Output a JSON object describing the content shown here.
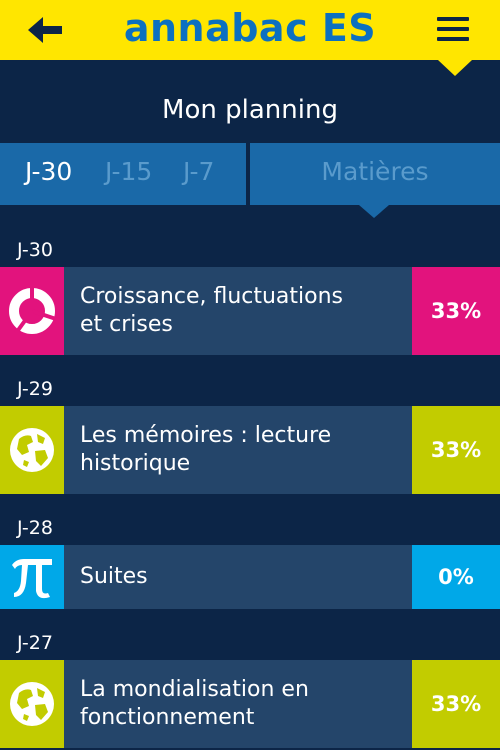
{
  "header": {
    "back_icon": "arrow-left-icon",
    "title": "annabac ES",
    "menu_icon": "hamburger-menu-icon",
    "colors": {
      "bar": "#ffe600",
      "title": "#0c70c0"
    }
  },
  "page": {
    "title": "Mon planning"
  },
  "tabs": {
    "days": [
      {
        "label": "J-30",
        "active": true
      },
      {
        "label": "J-15",
        "active": false
      },
      {
        "label": "J-7",
        "active": false
      }
    ],
    "subjects_label": "Matières",
    "selected": "Matières"
  },
  "planning": [
    {
      "day": "J-30",
      "title_lines": [
        "Croissance, fluctuations",
        "et crises"
      ],
      "percent": "33%",
      "color": "#e2137d",
      "icon": "economics-ring-icon"
    },
    {
      "day": "J-29",
      "title_lines": [
        "Les mémoires : lecture",
        "historique"
      ],
      "percent": "33%",
      "color": "#c2cc00",
      "icon": "globe-icon"
    },
    {
      "day": "J-28",
      "title_lines": [
        "Suites"
      ],
      "percent": "0%",
      "color": "#00a8e8",
      "icon": "pi-icon"
    },
    {
      "day": "J-27",
      "title_lines": [
        "La mondialisation en",
        "fonctionnement"
      ],
      "percent": "33%",
      "color": "#c2cc00",
      "icon": "globe-icon"
    }
  ]
}
